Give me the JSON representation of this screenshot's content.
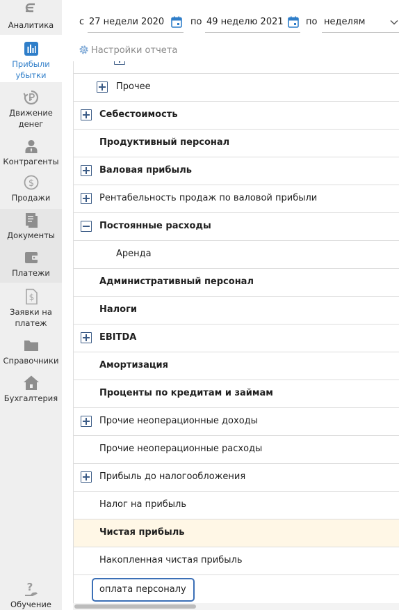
{
  "sidebar": {
    "items": [
      {
        "label": "Аналитика",
        "icon": "analytics-icon"
      },
      {
        "label": "Прибыли убытки",
        "icon": "bar-chart-icon",
        "active": true
      },
      {
        "label": "Движение денег",
        "icon": "money-flow-icon"
      },
      {
        "label": "Контрагенты",
        "icon": "person-icon"
      },
      {
        "label": "Продажи",
        "icon": "dollar-circle-icon"
      },
      {
        "label": "Документы",
        "icon": "documents-icon"
      },
      {
        "label": "Платежи",
        "icon": "wallet-icon"
      },
      {
        "label": "Заявки на платеж",
        "icon": "payment-request-icon"
      },
      {
        "label": "Справочники",
        "icon": "folder-icon"
      },
      {
        "label": "Бухгалтерия",
        "icon": "accounting-house-icon"
      },
      {
        "label": "Обучение",
        "icon": "help-icon"
      }
    ]
  },
  "filters": {
    "from_label": "с",
    "from_value": "27 недели 2020",
    "to_label": "по",
    "to_value": "49 неделю 2021",
    "group_label": "по",
    "group_value": "неделям"
  },
  "settings_link": "Настройки отчета",
  "table": {
    "rows": [
      {
        "label": "Прочее",
        "toggle": "plus",
        "bold": false
      },
      {
        "label": "Себестоимость",
        "toggle": "plus",
        "bold": true
      },
      {
        "label": "Продуктивный персонал",
        "toggle": null,
        "bold": true
      },
      {
        "label": "Валовая прибыль",
        "toggle": "plus",
        "bold": true
      },
      {
        "label": "Рентабельность продаж по валовой прибыли",
        "toggle": "plus",
        "bold": false
      },
      {
        "label": "Постоянные расходы",
        "toggle": "minus",
        "bold": true
      },
      {
        "label": "Аренда",
        "toggle": null,
        "bold": false
      },
      {
        "label": "Административный персонал",
        "toggle": null,
        "bold": true
      },
      {
        "label": "Налоги",
        "toggle": null,
        "bold": true
      },
      {
        "label": "EBITDA",
        "toggle": "plus",
        "bold": true
      },
      {
        "label": "Амортизация",
        "toggle": null,
        "bold": true
      },
      {
        "label": "Проценты по кредитам и займам",
        "toggle": null,
        "bold": true
      },
      {
        "label": "Прочие неоперационные доходы",
        "toggle": "plus",
        "bold": false
      },
      {
        "label": "Прочие неоперационные расходы",
        "toggle": null,
        "bold": false
      },
      {
        "label": "Прибыль до налогообложения",
        "toggle": "plus",
        "bold": false
      },
      {
        "label": "Налог на прибыль",
        "toggle": null,
        "bold": false
      },
      {
        "label": "Чистая прибыль",
        "toggle": null,
        "bold": true,
        "highlight": true
      },
      {
        "label": "Накопленная чистая прибыль",
        "toggle": null,
        "bold": false
      }
    ],
    "new_row_input": "оплата персоналу"
  },
  "colors": {
    "accent": "#2f7ec9",
    "toggle": "#3b5b86",
    "highlight_row": "#fff7e6",
    "sidebar_bg": "#efefef"
  }
}
